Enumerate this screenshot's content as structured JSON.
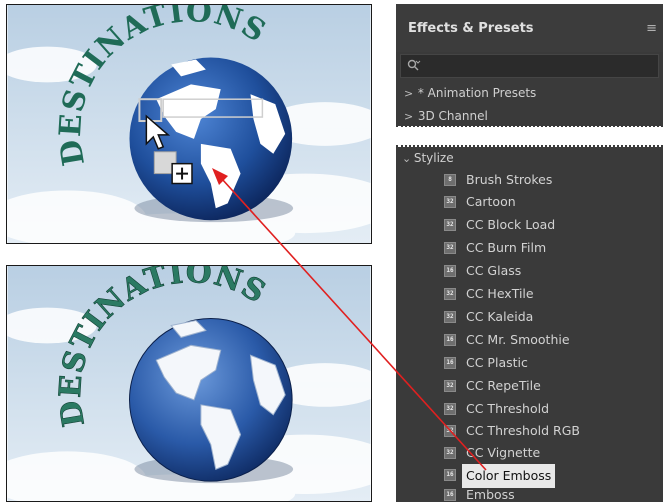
{
  "comp": {
    "title_text": "DESTINATIONS"
  },
  "panel": {
    "title": "Effects & Presets",
    "search_placeholder": "",
    "categories": [
      {
        "twisty": ">",
        "label": "* Animation Presets"
      },
      {
        "twisty": ">",
        "label": "3D Channel"
      }
    ],
    "open_category": {
      "twisty": "v",
      "label": "Stylize"
    },
    "effects": [
      {
        "icon": "8",
        "label": "Brush Strokes"
      },
      {
        "icon": "32",
        "label": "Cartoon"
      },
      {
        "icon": "32",
        "label": "CC Block Load"
      },
      {
        "icon": "32",
        "label": "CC Burn Film"
      },
      {
        "icon": "16",
        "label": "CC Glass"
      },
      {
        "icon": "32",
        "label": "CC HexTile"
      },
      {
        "icon": "32",
        "label": "CC Kaleida"
      },
      {
        "icon": "16",
        "label": "CC Mr. Smoothie"
      },
      {
        "icon": "16",
        "label": "CC Plastic"
      },
      {
        "icon": "32",
        "label": "CC RepeTile"
      },
      {
        "icon": "32",
        "label": "CC Threshold"
      },
      {
        "icon": "32",
        "label": "CC Threshold RGB"
      },
      {
        "icon": "32",
        "label": "CC Vignette"
      },
      {
        "icon": "16",
        "label": "Color Emboss"
      },
      {
        "icon": "16",
        "label": "Emboss"
      }
    ],
    "selected_effect": "Color Emboss"
  },
  "colors": {
    "panel_bg": "#3a3a3a",
    "globe_blue": "#1f4f9c",
    "title_green": "#1f6b57",
    "arrow_red": "#e02020"
  }
}
